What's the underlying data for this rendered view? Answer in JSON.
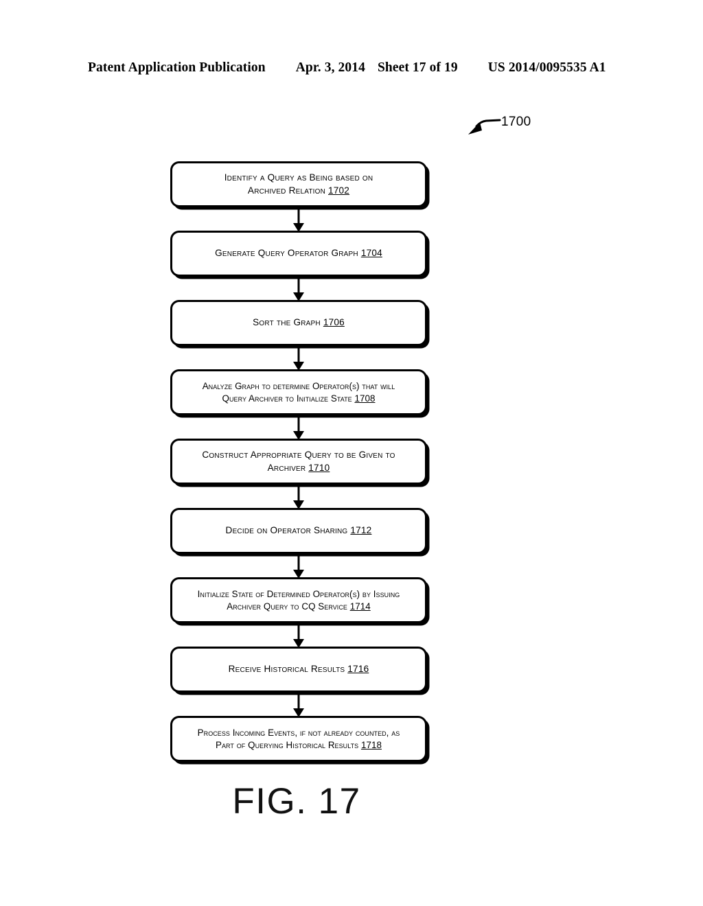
{
  "header": {
    "publication": "Patent Application Publication",
    "date": "Apr. 3, 2014",
    "sheet": "Sheet 17 of 19",
    "patent_number": "US 2014/0095535 A1"
  },
  "figure": {
    "callout_label": "1700",
    "caption": "FIG. 17"
  },
  "flowchart": {
    "nodes": [
      {
        "id": "1702",
        "text": "Identify a Query as Being based on\nArchived Relation ",
        "ref": "1702",
        "lines": 2
      },
      {
        "id": "1704",
        "text": "Generate Query Operator Graph ",
        "ref": "1704",
        "lines": 1
      },
      {
        "id": "1706",
        "text": "Sort the Graph ",
        "ref": "1706",
        "lines": 1
      },
      {
        "id": "1708",
        "text": "Analyze Graph to determine Operator(s) that will\nQuery Archiver to Initialize State ",
        "ref": "1708",
        "lines": 2
      },
      {
        "id": "1710",
        "text": "Construct Appropriate Query to be Given to\nArchiver ",
        "ref": "1710",
        "lines": 2
      },
      {
        "id": "1712",
        "text": "Decide on Operator Sharing ",
        "ref": "1712",
        "lines": 1
      },
      {
        "id": "1714",
        "text": "Initialize State of Determined Operator(s) by Issuing\nArchiver Query to CQ Service ",
        "ref": "1714",
        "lines": 2
      },
      {
        "id": "1716",
        "text": "Receive Historical Results ",
        "ref": "1716",
        "lines": 1
      },
      {
        "id": "1718",
        "text": "Process Incoming Events, if not already counted, as\nPart of Querying Historical Results ",
        "ref": "1718",
        "lines": 2
      }
    ]
  }
}
